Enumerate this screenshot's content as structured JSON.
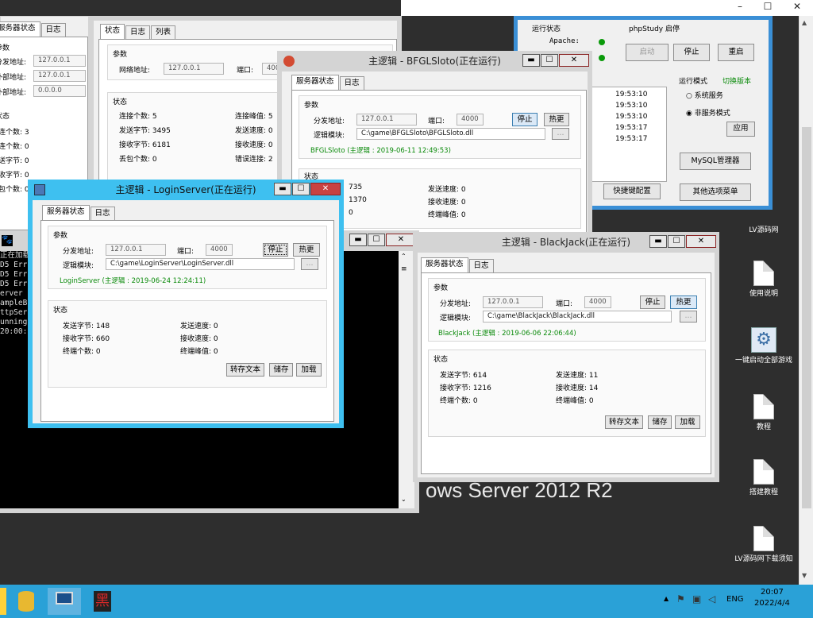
{
  "explorer_window": {
    "tabs": [
      "服务器状态",
      "日志"
    ]
  },
  "left_window": {
    "tabs": [
      "服务器状态",
      "日志"
    ],
    "params_title": "参数",
    "labels": [
      "分发地址:",
      "外部地址:",
      "外部地址:"
    ],
    "values": [
      "127.0.0.1",
      "127.0.0.1",
      "0.0.0.0"
    ],
    "status_title": "状态",
    "stats": [
      "连个数: 3",
      "连个数: 0",
      "送字节: 0",
      "收字节: 0",
      "包个数: 0"
    ]
  },
  "net_window": {
    "tabs": [
      "状态",
      "日志",
      "列表"
    ],
    "params_title": "参数",
    "addr_label": "网络地址:",
    "addr_value": "127.0.0.1",
    "port_label": "端口:",
    "port_value": "4000",
    "status_title": "状态",
    "stats_left": [
      "连接个数: 5",
      "发送字节: 3495",
      "接收字节: 6181",
      "丢包个数: 0"
    ],
    "stats_right": [
      "连接峰值: 5",
      "发送速度: 0",
      "接收速度: 0",
      "错误连接: 2"
    ]
  },
  "phpstudy": {
    "run_status": "运行状态",
    "app": "phpStudy  启停",
    "apache": "Apache:",
    "mysql": "MySQL:",
    "start": "启动",
    "stop": "停止",
    "restart": "重启",
    "log_times": [
      "19:53:10",
      "19:53:10",
      "19:53:10",
      "19:53:17",
      "19:53:17"
    ],
    "run_mode": "运行模式",
    "switch_version": "切换版本",
    "system_service": "系统服务",
    "non_service": "非服务模式",
    "apply": "应用",
    "mysql_manager": "MySQL管理器",
    "quick_config": "快捷键配置",
    "other_menu": "其他选项菜单"
  },
  "bfgl": {
    "title": "主逻辑 - BFGLSloto(正在运行)",
    "tabs": [
      "服务器状态",
      "日志"
    ],
    "params_title": "参数",
    "addr_label": "分发地址:",
    "addr_value": "127.0.0.1",
    "port_label": "端口:",
    "port_value": "4000",
    "stop": "停止",
    "hot": "热更",
    "module_label": "逻辑模块:",
    "module_value": "C:\\game\\BFGLSloto\\BFGLSloto.dll",
    "browse": "...",
    "info": "BFGLSloto (主逻辑 : 2019-06-11 12:49:53)",
    "status_title": "状态",
    "stats_left": [
      "735",
      "1370",
      "0"
    ],
    "stats_right": [
      "发送速度: 0",
      "接收速度: 0",
      "终端峰值: 0"
    ]
  },
  "login": {
    "title": "主逻辑 - LoginServer(正在运行)",
    "tabs": [
      "服务器状态",
      "日志"
    ],
    "params_title": "参数",
    "addr_label": "分发地址:",
    "addr_value": "127.0.0.1",
    "port_label": "端口:",
    "port_value": "4000",
    "stop": "停止",
    "hot": "热更",
    "module_label": "逻辑模块:",
    "module_value": "C:\\game\\LoginServer\\LoginServer.dll",
    "browse": "...",
    "info": "LoginServer (主逻辑 : 2019-06-24 12:24:11)",
    "status_title": "状态",
    "stats_left": [
      "发送字节: 148",
      "接收字节: 660",
      "终端个数: 0"
    ],
    "stats_right": [
      "发送速度: 0",
      "接收速度: 0",
      "终端峰值: 0"
    ],
    "dump": "转存文本",
    "save": "储存",
    "load": "加载"
  },
  "console": {
    "lines": [
      "正在加载",
      "D5 Err",
      "D5 Err",
      "D5 Err",
      "erver",
      "ampleB",
      "ttpSer",
      "unning",
      "20:00:"
    ]
  },
  "blackjack": {
    "title": "主逻辑 - BlackJack(正在运行)",
    "tabs": [
      "服务器状态",
      "日志"
    ],
    "params_title": "参数",
    "addr_label": "分发地址:",
    "addr_value": "127.0.0.1",
    "port_label": "端口:",
    "port_value": "4000",
    "stop": "停止",
    "hot": "热更",
    "module_label": "逻辑模块:",
    "module_value": "C:\\game\\BlackJack\\BlackJack.dll",
    "browse": "...",
    "info": "BlackJack (主逻辑 : 2019-06-06 22:06:44)",
    "status_title": "状态",
    "stats_left": [
      "发送字节: 614",
      "接收字节: 1216",
      "终端个数: 0"
    ],
    "stats_right": [
      "发送速度: 11",
      "接收速度: 14",
      "终端峰值: 0"
    ],
    "dump": "转存文本",
    "save": "储存",
    "load": "加载"
  },
  "desktop": {
    "watermark": "ows Server 2012 R2",
    "icons": [
      "LV源码网",
      "使用说明",
      "一键启动全部游戏",
      "教程",
      "搭建教程",
      "LV源码网下载须知"
    ]
  },
  "topbar": {
    "min": "–",
    "max": "☐",
    "close": "✕"
  },
  "taskbar": {
    "lang": "ENG",
    "time": "20:07",
    "date": "2022/4/4",
    "arrow": "▲"
  }
}
